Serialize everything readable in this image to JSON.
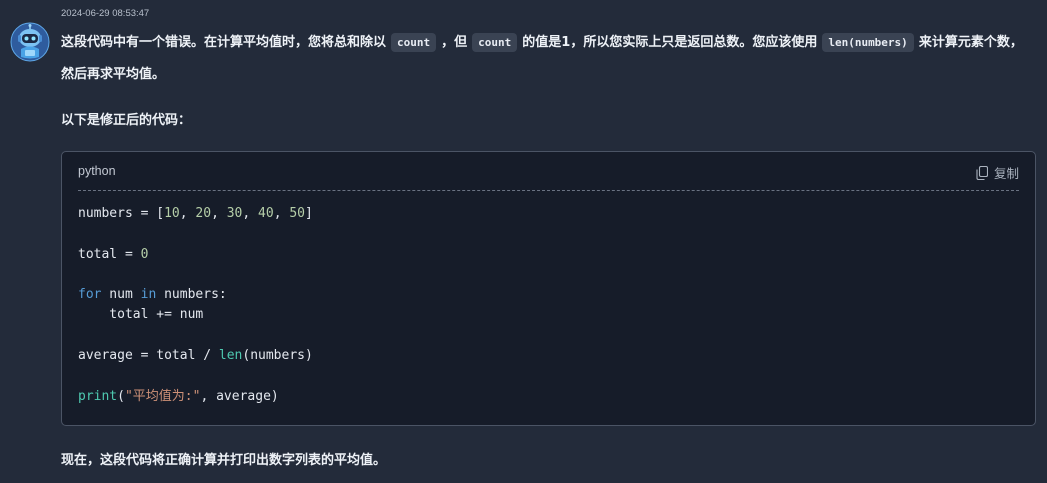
{
  "message": {
    "timestamp": "2024-06-29 08:53:47",
    "intro": {
      "t1": "这段代码中有一个错误。在计算平均值时，您将总和除以",
      "code1": "count",
      "t2": "，但",
      "code2": "count",
      "t3": "的值是1，所以您实际上只是返回总数。您应该使用",
      "code3": "len(numbers)",
      "t4": "来计算元素个数，然后再求平均值。"
    },
    "label": "以下是修正后的代码：",
    "code_block": {
      "language": "python",
      "copy_label": "复制",
      "lines": {
        "l1": {
          "a": "numbers = [",
          "n1": "10",
          "s1": ", ",
          "n2": "20",
          "s2": ", ",
          "n3": "30",
          "s3": ", ",
          "n4": "40",
          "s4": ", ",
          "n5": "50",
          "b": "]"
        },
        "l2": {
          "a": "total = ",
          "n": "0"
        },
        "l3": {
          "kw1": "for",
          "a": " num ",
          "kw2": "in",
          "b": " numbers:"
        },
        "l4": {
          "a": "    total += num"
        },
        "l5": {
          "a": "average = total / ",
          "fn": "len",
          "b": "(numbers)"
        },
        "l6": {
          "fn": "print",
          "a": "(",
          "str": "\"平均值为:\"",
          "b": ", average)"
        }
      }
    },
    "footer": "现在，这段代码将正确计算并打印出数字列表的平均值。"
  },
  "colors": {
    "background": "#232b3a",
    "code_background": "#161c29",
    "keyword": "#569cd6",
    "number": "#b5cea8",
    "builtin": "#4ec9b0",
    "string": "#ce9178"
  },
  "icons": {
    "avatar": "robot-avatar-icon",
    "copy": "copy-icon"
  }
}
